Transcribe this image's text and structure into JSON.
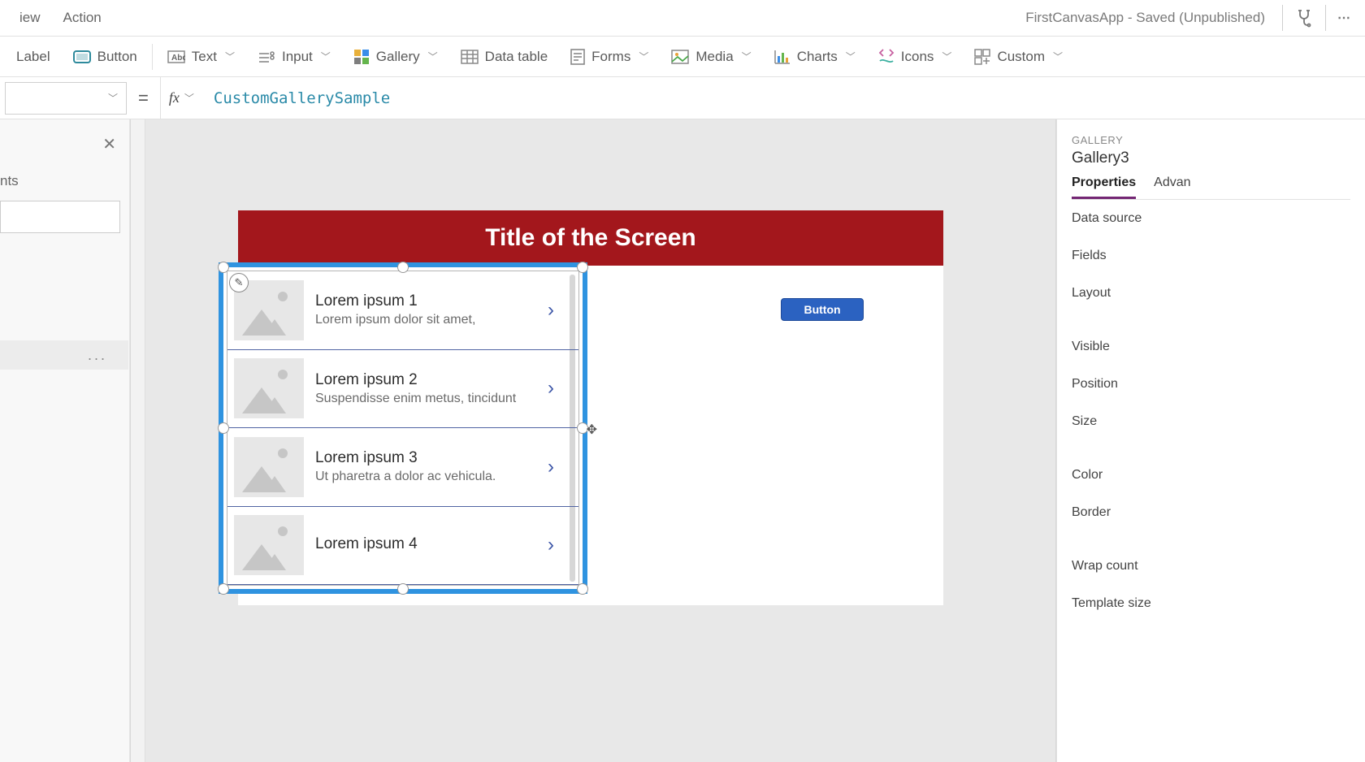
{
  "top": {
    "menu1": "iew",
    "menu2": "Action",
    "app_title": "FirstCanvasApp - Saved (Unpublished)"
  },
  "ribbon": {
    "label": "Label",
    "button": "Button",
    "text": "Text",
    "input": "Input",
    "gallery": "Gallery",
    "datatable": "Data table",
    "forms": "Forms",
    "media": "Media",
    "charts": "Charts",
    "icons": "Icons",
    "custom": "Custom"
  },
  "formula": {
    "equals": "=",
    "fx": "fx",
    "value": "CustomGallerySample"
  },
  "leftPanel": {
    "tree_suffix": "nts",
    "ellipsis": "..."
  },
  "canvas": {
    "screen_title": "Title of the Screen",
    "button_label": "Button"
  },
  "gallery": {
    "items": [
      {
        "title": "Lorem ipsum 1",
        "sub": "Lorem ipsum dolor sit amet,"
      },
      {
        "title": "Lorem ipsum 2",
        "sub": "Suspendisse enim metus, tincidunt"
      },
      {
        "title": "Lorem ipsum 3",
        "sub": "Ut pharetra a dolor ac vehicula."
      },
      {
        "title": "Lorem ipsum 4",
        "sub": ""
      }
    ]
  },
  "rightPanel": {
    "category": "GALLERY",
    "name": "Gallery3",
    "tab_properties": "Properties",
    "tab_advanced": "Advan",
    "props": {
      "data_source": "Data source",
      "fields": "Fields",
      "layout": "Layout",
      "visible": "Visible",
      "position": "Position",
      "size": "Size",
      "color": "Color",
      "border": "Border",
      "wrap_count": "Wrap count",
      "template_size": "Template size"
    }
  }
}
